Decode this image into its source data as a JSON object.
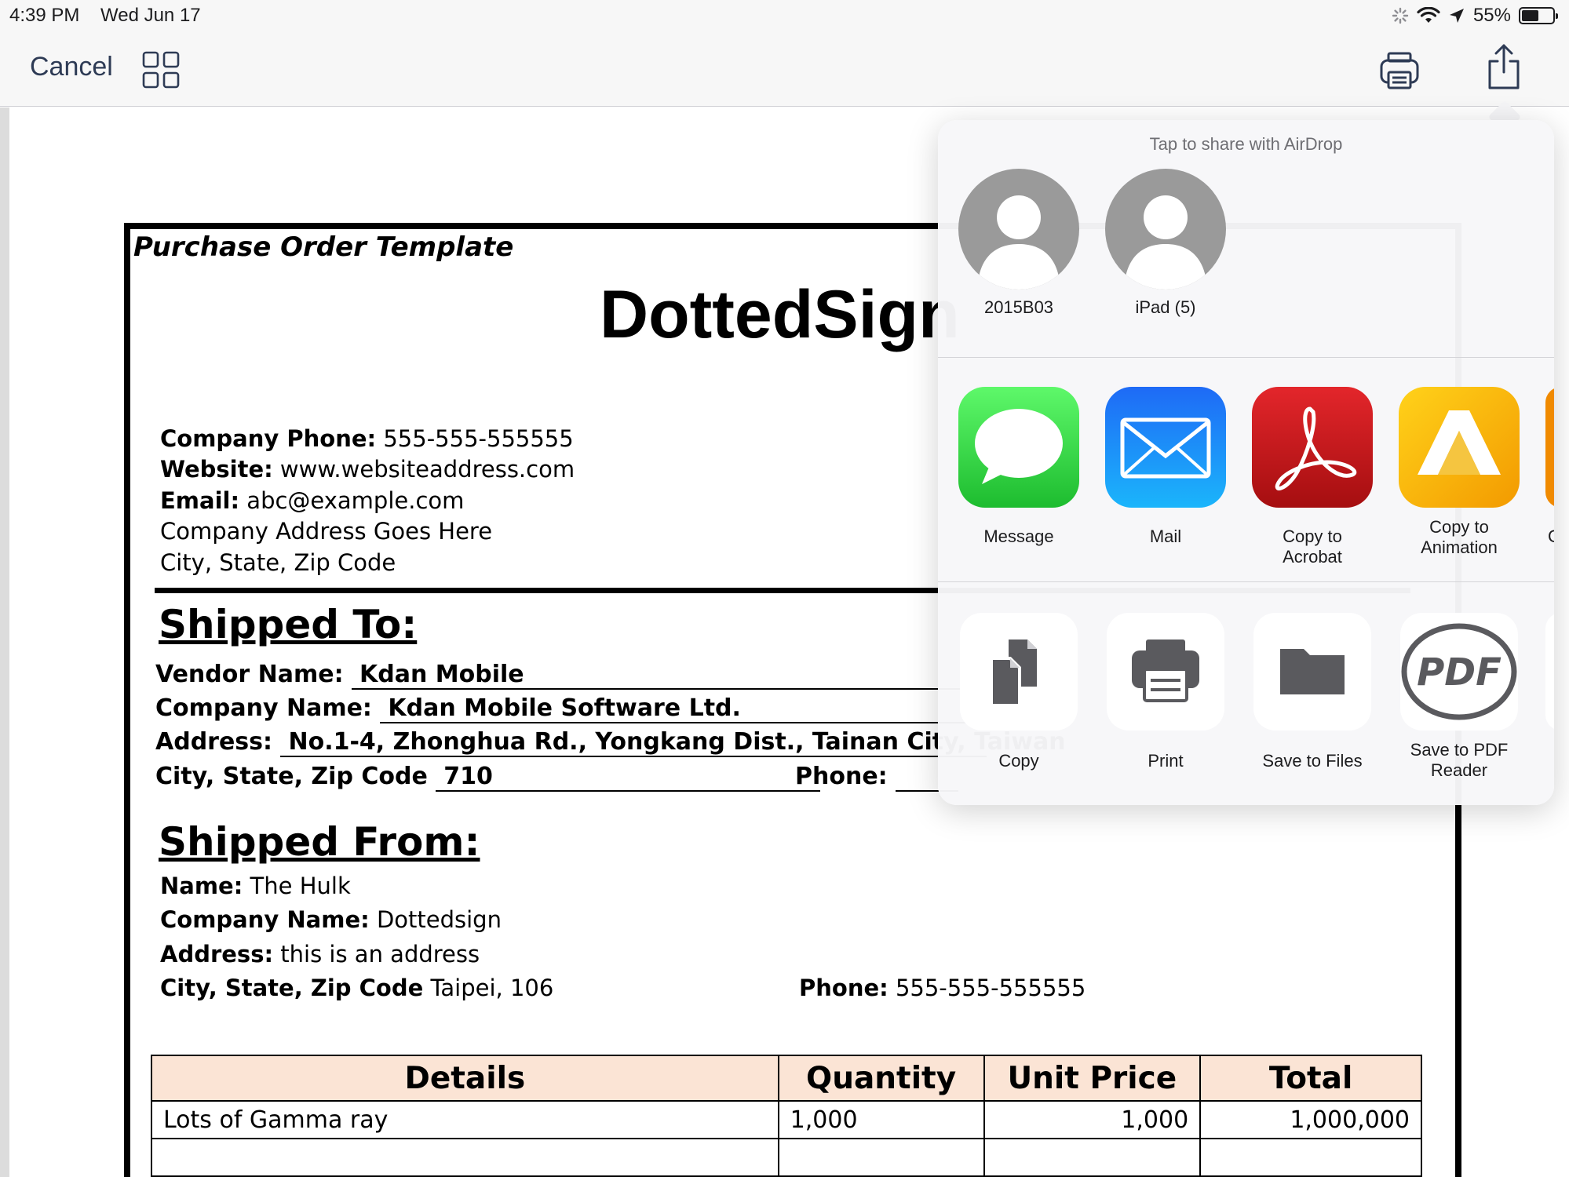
{
  "status_bar": {
    "time": "4:39 PM",
    "date": "Wed Jun 17",
    "battery_text": "55%",
    "battery_level": 0.55
  },
  "nav": {
    "cancel_label": "Cancel",
    "grid_icon": "grid-icon",
    "print_icon": "print-icon",
    "share_icon": "share-icon"
  },
  "document": {
    "heading": "Purchase Order Template",
    "brand": "DottedSign",
    "company_info": [
      {
        "label": "Company Phone:",
        "value": " 555-555-555555"
      },
      {
        "label": "Website:",
        "value": " www.websiteaddress.com"
      },
      {
        "label": "Email:",
        "value": " abc@example.com"
      },
      {
        "label": "",
        "value": "Company Address Goes Here"
      },
      {
        "label": "",
        "value": "City, State, Zip Code"
      }
    ],
    "shipped_to": {
      "title": "Shipped To:",
      "vendor_label": "Vendor Name:",
      "vendor_value": "Kdan Mobile",
      "company_label": "Company Name:",
      "company_value": "Kdan Mobile Software Ltd.",
      "address_label": "Address:",
      "address_value": "No.1-4, Zhonghua Rd., Yongkang Dist., Tainan City, Taiwan",
      "city_label": "City, State, Zip Code",
      "city_value": "710",
      "phone_label": "Phone:"
    },
    "shipped_from": {
      "title": "Shipped From:",
      "name_label": "Name:",
      "name_value": " The Hulk",
      "company_label": "Company Name:",
      "company_value": " Dottedsign",
      "address_label": "Address:",
      "address_value": " this is an address",
      "city_label": "City, State, Zip Code",
      "city_value": " Taipei, 106",
      "phone_label": "Phone:",
      "phone_value": " 555-555-555555"
    },
    "table": {
      "headers": [
        "Details",
        "Quantity",
        "Unit Price",
        "Total"
      ],
      "rows": [
        [
          "Lots of Gamma ray",
          "1,000",
          "1,000",
          "1,000,000"
        ],
        [
          "",
          "",
          "",
          ""
        ]
      ]
    }
  },
  "share_sheet": {
    "airdrop_title": "Tap to share with AirDrop",
    "contacts": [
      {
        "name": "2015B03"
      },
      {
        "name": "iPad (5)"
      }
    ],
    "apps": [
      {
        "label": "Message",
        "icon": "messages-icon",
        "color": "#2ecc40"
      },
      {
        "label": "Mail",
        "icon": "mail-icon",
        "color": "#1a8cff"
      },
      {
        "label": "Copy to Acrobat",
        "icon": "acrobat-icon",
        "color": "#d7191c"
      },
      {
        "label": "Copy to Animation",
        "icon": "animation-icon",
        "color": "#f5a300"
      }
    ],
    "actions": [
      {
        "label": "Copy",
        "icon": "copy-icon"
      },
      {
        "label": "Print",
        "icon": "print-icon"
      },
      {
        "label": "Save to Files",
        "icon": "folder-icon"
      },
      {
        "label": "Save to PDF Reader",
        "icon": "pdf-icon"
      }
    ],
    "partial_label": "C"
  }
}
